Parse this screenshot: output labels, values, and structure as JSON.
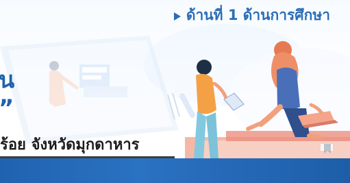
{
  "header": {
    "section_label": "ด้านที่ 1 ด้านการศึกษา"
  },
  "headline": {
    "line1": "น",
    "line2": "”"
  },
  "caption": {
    "text": "ร้อย จังหวัดมุกดาหาร"
  },
  "icons": {
    "bullet": "triangle-bullet-icon",
    "illustration": "students-laptop-illustration"
  },
  "colors": {
    "accent": "#2B6EB5",
    "headline": "#1E63AE",
    "bottom_bar": "#1f63b0"
  }
}
